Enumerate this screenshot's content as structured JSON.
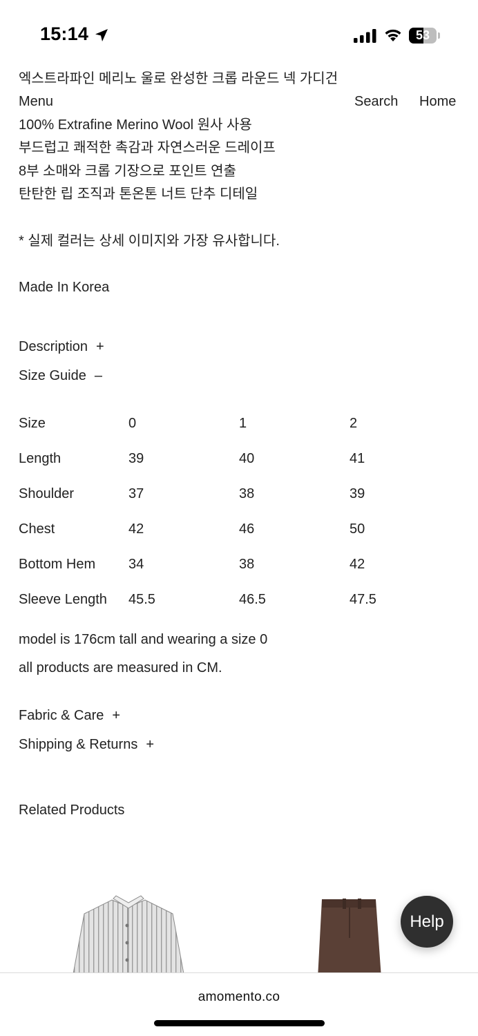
{
  "status_bar": {
    "time": "15:14",
    "battery_level": "53",
    "icons": [
      "location-arrow-icon",
      "cellular-signal-icon",
      "wifi-icon",
      "battery-icon"
    ]
  },
  "header": {
    "product_title": "엑스트라파인 메리노 울로 완성한 크롭 라운드 넥 가디건",
    "menu_label": "Menu",
    "search_label": "Search",
    "home_label": "Home"
  },
  "description": {
    "lines": [
      "100% Extrafine Merino Wool 원사 사용",
      "부드럽고 쾌적한 촉감과 자연스러운 드레이프",
      "8부 소매와 크롭 기장으로 포인트 연출",
      "탄탄한 립 조직과 톤온톤 너트 단추 디테일"
    ],
    "color_note": "* 실제 컬러는 상세 이미지와 가장 유사합니다.",
    "origin": "Made In Korea"
  },
  "accordions": {
    "description": {
      "label": "Description",
      "sign": "+"
    },
    "size_guide": {
      "label": "Size Guide",
      "sign": "–"
    },
    "fabric_care": {
      "label": "Fabric & Care",
      "sign": "+"
    },
    "shipping_returns": {
      "label": "Shipping & Returns",
      "sign": "+"
    }
  },
  "size_table": {
    "rows": [
      [
        "Size",
        "0",
        "1",
        "2"
      ],
      [
        "Length",
        "39",
        "40",
        "41"
      ],
      [
        "Shoulder",
        "37",
        "38",
        "39"
      ],
      [
        "Chest",
        "42",
        "46",
        "50"
      ],
      [
        "Bottom Hem",
        "34",
        "38",
        "42"
      ],
      [
        "Sleeve Length",
        "45.5",
        "46.5",
        "47.5"
      ]
    ],
    "note_model": "model is 176cm tall and wearing a size 0",
    "note_units": "all products are measured in CM."
  },
  "related": {
    "heading": "Related Products"
  },
  "help_label": "Help",
  "browser": {
    "url": "amomento.co"
  },
  "colors": {
    "text": "#222222",
    "help_bg": "#2f2f2f",
    "shirt": "#d9d9d9",
    "pants": "#5a4036"
  }
}
